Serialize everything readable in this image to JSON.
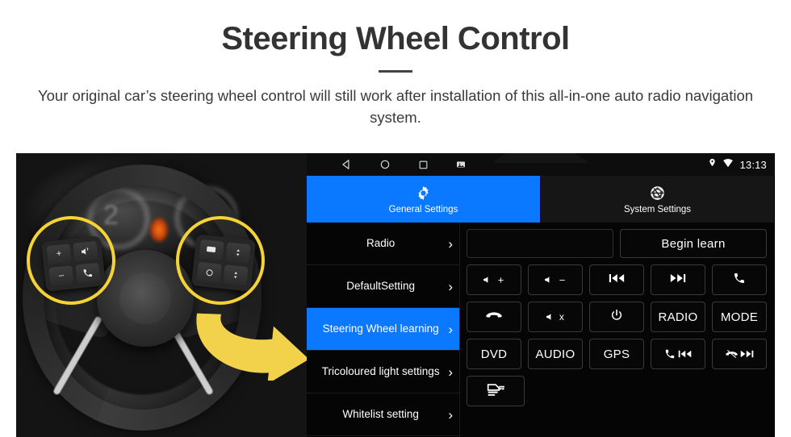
{
  "header": {
    "title": "Steering Wheel Control",
    "subtitle": "Your original car’s steering wheel control will still work after installation of this all-in-one auto radio navigation system."
  },
  "photo": {
    "alt": "steering-wheel-photo",
    "highlight_color": "#F5D335",
    "arrow_color": "#F2D24B",
    "left_pad_keys": [
      "+",
      "—",
      "volume-speaker",
      "phone-call"
    ],
    "right_pad_keys": [
      "display-mode",
      "arrow-up",
      "circle",
      "arrow-down"
    ]
  },
  "unit": {
    "statusbar": {
      "nav_icons": [
        "back-icon",
        "home-icon",
        "recents-icon",
        "screenshot-icon"
      ],
      "status_icons": [
        "location-pin-icon",
        "wifi-icon"
      ],
      "clock": "13:13"
    },
    "tabs": [
      {
        "label": "General Settings",
        "icon": "gear-icon",
        "active": true
      },
      {
        "label": "System Settings",
        "icon": "shutter-icon",
        "active": false
      }
    ],
    "sidebar": [
      {
        "label": "Radio",
        "active": false
      },
      {
        "label": "DefaultSetting",
        "active": false
      },
      {
        "label": "Steering Wheel learning",
        "active": true
      },
      {
        "label": "Tricoloured light settings",
        "active": false
      },
      {
        "label": "Whitelist setting",
        "active": false
      }
    ],
    "sidebar_chevron": "›",
    "panel": {
      "input_value": "",
      "begin_learn_label": "Begin learn",
      "rows": [
        [
          {
            "name": "volume-up-button",
            "icon": "speaker-plus",
            "label": ""
          },
          {
            "name": "volume-down-button",
            "icon": "speaker-minus",
            "label": ""
          },
          {
            "name": "previous-track-button",
            "icon": "prev-track",
            "label": ""
          },
          {
            "name": "next-track-button",
            "icon": "next-track",
            "label": ""
          },
          {
            "name": "call-button",
            "icon": "phone",
            "label": ""
          }
        ],
        [
          {
            "name": "hangup-button",
            "icon": "phone-hangup",
            "label": ""
          },
          {
            "name": "mute-button",
            "icon": "speaker-mute",
            "label": ""
          },
          {
            "name": "power-button",
            "icon": "power",
            "label": ""
          },
          {
            "name": "radio-button",
            "icon": "",
            "label": "RADIO"
          },
          {
            "name": "mode-button",
            "icon": "",
            "label": "MODE"
          }
        ],
        [
          {
            "name": "dvd-button",
            "icon": "",
            "label": "DVD"
          },
          {
            "name": "audio-button",
            "icon": "",
            "label": "AUDIO"
          },
          {
            "name": "gps-button",
            "icon": "",
            "label": "GPS"
          },
          {
            "name": "call-prev-button",
            "icon": "phone-prev",
            "label": ""
          },
          {
            "name": "hangup-next-button",
            "icon": "hangup-next",
            "label": ""
          }
        ],
        [
          {
            "name": "carplay-button",
            "icon": "car-nav",
            "label": ""
          }
        ]
      ]
    }
  },
  "colors": {
    "accent_blue": "#0A78FF",
    "panel_black": "#050505",
    "highlight_yellow": "#F5D335"
  }
}
